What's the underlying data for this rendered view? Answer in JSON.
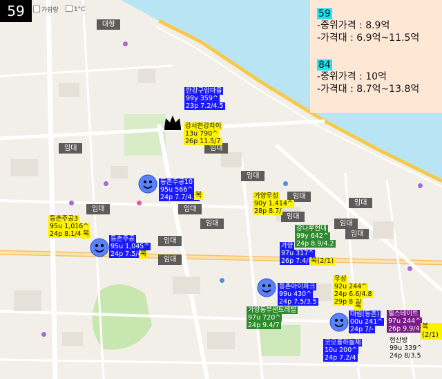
{
  "badge": "59",
  "toolbar": {
    "opt1": "가람량",
    "opt2": "1°C"
  },
  "info_panel": {
    "sections": [
      {
        "size": "59",
        "lines": [
          "-중위가격 :  8.9억",
          "-가격대 : 6.9억~11.5억"
        ]
      },
      {
        "size": "84",
        "lines": [
          "-중위가격 : 10억",
          "-가격대 : 8.7억~13.8억"
        ]
      }
    ]
  },
  "rental_labels": [
    "대형",
    "임대",
    "임대",
    "임대",
    "임대",
    "임대",
    "임대",
    "임대",
    "임대",
    "임대",
    "임대",
    "임대",
    "임대",
    "임대"
  ],
  "apartments": [
    {
      "lines": [
        "한강구암마을",
        "99y 359^",
        "23p 7.2/4.5"
      ],
      "style": "t-lblue"
    },
    {
      "lines": [
        "강서한강자이",
        "13u 790^",
        "26p 11.5/7"
      ],
      "style": "t-yellow"
    },
    {
      "lines": [
        "등촌주공10",
        "95u 566^",
        "24p 7.7/4.4"
      ],
      "style": "t-lblue"
    },
    {
      "lines": [
        "가양우성",
        "90y 1,414^",
        "28p 8.7/"
      ],
      "style": "t-yellow"
    },
    {
      "lines": [
        "등촌주공3",
        "95u 1,016^",
        "24p 8.1/4.5"
      ],
      "style": "t-yellow"
    },
    {
      "lines": [
        "등촌주공",
        "95u 1,045^",
        "24p 7.5/4"
      ],
      "style": "t-lblue"
    },
    {
      "lines": [
        "강나루현대",
        "99y 642^",
        "24p 8.9/4.2"
      ],
      "style": "t-green"
    },
    {
      "lines": [
        "가양",
        "97u 317^",
        "26p 7.4/4"
      ],
      "style": "t-lblue"
    },
    {
      "lines": [
        "등촌아이파크",
        "99u 430^",
        "24p 7.5/3.5"
      ],
      "style": "t-lblue"
    },
    {
      "lines": [
        "우성",
        "92u 244^",
        "24p 6.6/4.8",
        "29p 8.2/"
      ],
      "style": "t-yellow"
    },
    {
      "lines": [
        "가양동부센트레빌",
        "97u 720^",
        "24p 9.4/7"
      ],
      "style": "t-green"
    },
    {
      "lines": [
        "대림(등촌)",
        "00u 241^",
        "24p 7/-"
      ],
      "style": "t-lblue"
    },
    {
      "lines": [
        "힐스테이트",
        "97u 244^",
        "26p 9.9/4.6"
      ],
      "style": "t-purple"
    },
    {
      "lines": [
        "코오롱하늘채",
        "10u 200^",
        "24p 7.2/4"
      ],
      "style": "t-lblue"
    },
    {
      "lines": [
        "현산방",
        "99u 339^",
        "24p 8/3.5"
      ],
      "style": "t-plain"
    }
  ],
  "notes": [
    "복",
    "복",
    "복",
    "복(2/1)",
    "복",
    "복(2/1)"
  ],
  "icons": [
    "smiley-icon",
    "crown-icon"
  ]
}
